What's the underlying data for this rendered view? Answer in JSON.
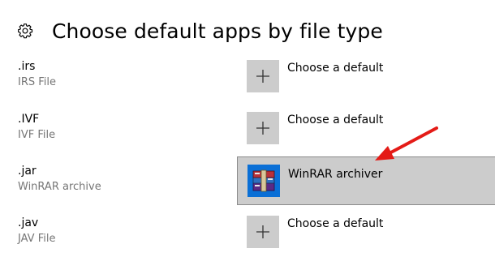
{
  "header": {
    "title": "Choose default apps by file type",
    "icon": "gear-icon"
  },
  "rows": [
    {
      "extension": ".irs",
      "description": "IRS File",
      "app_label": "Choose a default",
      "app_icon": "plus-icon",
      "selected": false
    },
    {
      "extension": ".IVF",
      "description": "IVF File",
      "app_label": "Choose a default",
      "app_icon": "plus-icon",
      "selected": false
    },
    {
      "extension": ".jar",
      "description": "WinRAR archive",
      "app_label": "WinRAR archiver",
      "app_icon": "winrar-icon",
      "selected": true
    },
    {
      "extension": ".jav",
      "description": "JAV File",
      "app_label": "Choose a default",
      "app_icon": "plus-icon",
      "selected": false
    }
  ],
  "colors": {
    "tile": "#cccccc",
    "selected_bg": "#cccccc",
    "winrar_tile": "#0a6fd6",
    "arrow": "#e41b17",
    "secondary_text": "#767676"
  }
}
